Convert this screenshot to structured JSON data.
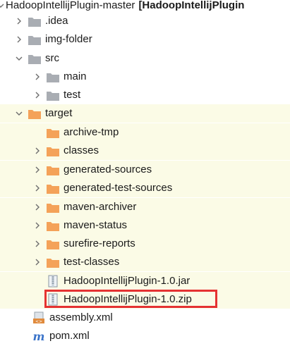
{
  "project_tree": {
    "root": {
      "name": "HadoopIntellijPlugin-master",
      "module_label": "[HadoopIntellijPlugin"
    },
    "items": [
      {
        "label": ".idea",
        "icon": "folder-gray"
      },
      {
        "label": "img-folder",
        "icon": "folder-gray"
      },
      {
        "label": "src",
        "icon": "folder-gray"
      },
      {
        "label": "main",
        "icon": "folder-gray"
      },
      {
        "label": "test",
        "icon": "folder-gray"
      },
      {
        "label": "target",
        "icon": "folder-orange"
      },
      {
        "label": "archive-tmp",
        "icon": "folder-orange"
      },
      {
        "label": "classes",
        "icon": "folder-orange"
      },
      {
        "label": "generated-sources",
        "icon": "folder-orange"
      },
      {
        "label": "generated-test-sources",
        "icon": "folder-orange"
      },
      {
        "label": "maven-archiver",
        "icon": "folder-orange"
      },
      {
        "label": "maven-status",
        "icon": "folder-orange"
      },
      {
        "label": "surefire-reports",
        "icon": "folder-orange"
      },
      {
        "label": "test-classes",
        "icon": "folder-orange"
      },
      {
        "label": "HadoopIntellijPlugin-1.0.jar",
        "icon": "archive-file"
      },
      {
        "label": "HadoopIntellijPlugin-1.0.zip",
        "icon": "archive-file"
      },
      {
        "label": "assembly.xml",
        "icon": "xml-file"
      },
      {
        "label": "pom.xml",
        "icon": "maven-file"
      }
    ]
  },
  "colors": {
    "gray_folder": "#a9adb3",
    "orange_folder": "#f4a259",
    "excluded_highlight": "#fbfbe6",
    "selection_box": "#e53232"
  }
}
